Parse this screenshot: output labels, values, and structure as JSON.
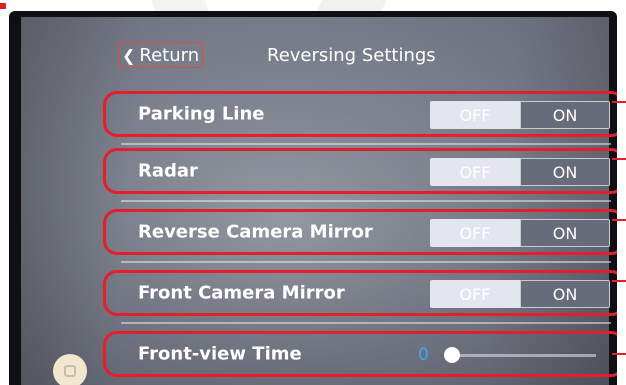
{
  "header": {
    "return_label": "Return",
    "title": "Reversing Settings"
  },
  "toggle_rows": [
    {
      "label": "Parking Line",
      "off_label": "OFF",
      "on_label": "ON",
      "state": "on"
    },
    {
      "label": "Radar",
      "off_label": "OFF",
      "on_label": "ON",
      "state": "on"
    },
    {
      "label": "Reverse Camera Mirror",
      "off_label": "OFF",
      "on_label": "ON",
      "state": "on"
    },
    {
      "label": "Front Camera Mirror",
      "off_label": "OFF",
      "on_label": "ON",
      "state": "on"
    }
  ],
  "front_view_time": {
    "label": "Front-view Time",
    "value": "0"
  },
  "icons": {
    "return": "chevron-left-icon",
    "home": "home-icon"
  },
  "colors": {
    "highlight": "#e51e2b",
    "slider_value": "#39a9ff",
    "toggle_on": "#676b7a",
    "toggle_off": "#e3e6ee"
  }
}
